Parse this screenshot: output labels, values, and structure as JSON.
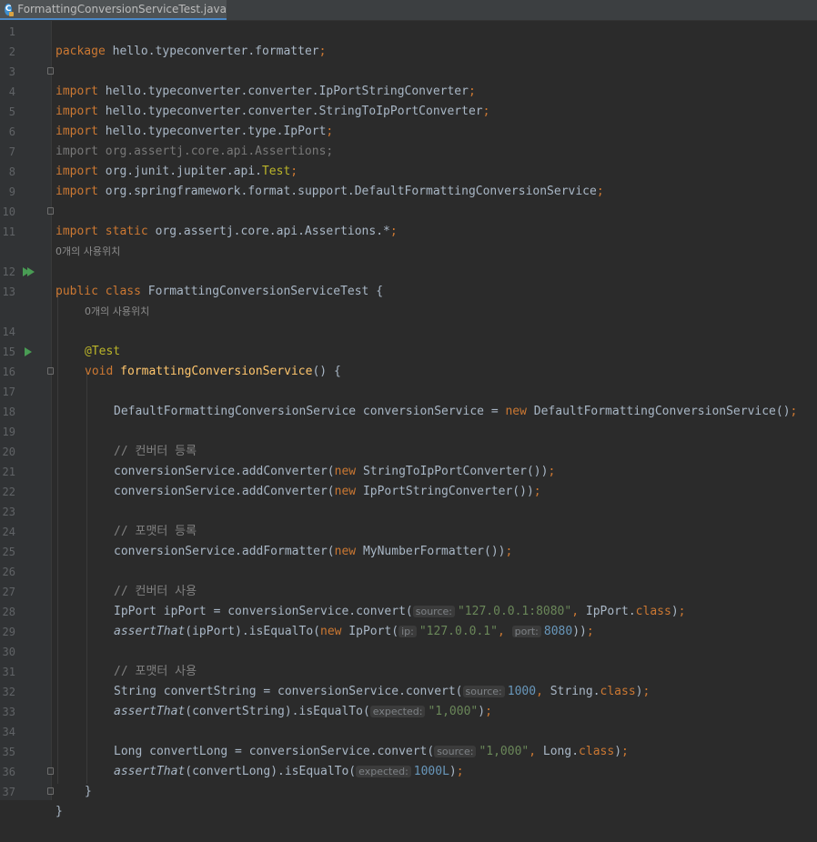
{
  "tab": {
    "title": "FormattingConversionServiceTest.java",
    "icon": "java-class-icon"
  },
  "colors": {
    "keyword": "#cc7832",
    "string": "#6a8759",
    "number": "#6897bb",
    "comment": "#808080",
    "annotation": "#bbb529",
    "method": "#ffc66d",
    "text": "#a9b7c6",
    "background": "#2b2b2b"
  },
  "hints": {
    "class_usages": "0개의 사용위치",
    "method_usages": "0개의 사용위치"
  },
  "line_numbers": [
    "1",
    "2",
    "3",
    "4",
    "5",
    "6",
    "7",
    "8",
    "9",
    "10",
    "11",
    "12",
    "13",
    "14",
    "15",
    "16",
    "17",
    "18",
    "19",
    "20",
    "21",
    "22",
    "23",
    "24",
    "25",
    "26",
    "27",
    "28",
    "29",
    "30",
    "31",
    "32",
    "33",
    "34",
    "35",
    "36",
    "37"
  ],
  "lines": {
    "l1": {
      "kw": "package",
      "rest": " hello.typeconverter.formatter",
      "semi": ";"
    },
    "l3": {
      "kw": "import",
      "rest": " hello.typeconverter.converter.IpPortStringConverter",
      "semi": ";"
    },
    "l4": {
      "kw": "import",
      "rest": " hello.typeconverter.converter.StringToIpPortConverter",
      "semi": ";"
    },
    "l5": {
      "kw": "import",
      "rest": " hello.typeconverter.type.IpPort",
      "semi": ";"
    },
    "l6": {
      "text": "import org.assertj.core.api.Assertions;"
    },
    "l7": {
      "kw": "import",
      "rest": " org.junit.jupiter.api.",
      "ann": "Test",
      "semi": ";"
    },
    "l8": {
      "kw": "import",
      "rest": " org.springframework.format.support.DefaultFormattingConversionService",
      "semi": ";"
    },
    "l10": {
      "kw": "import static",
      "rest": " org.assertj.core.api.Assertions.*",
      "semi": ";"
    },
    "l12": {
      "kw": "public class",
      "rest": " FormattingConversionServiceTest {"
    },
    "l14": {
      "ann": "@Test"
    },
    "l15": {
      "kw": "void",
      "fn": "formattingConversionService",
      "rest": "() {"
    },
    "l17": {
      "a": "DefaultFormattingConversionService conversionService = ",
      "kw": "new",
      "b": " DefaultFormattingConversionService()",
      "semi": ";"
    },
    "l19": {
      "cmt": "// 컨버터 등록"
    },
    "l20": {
      "a": "conversionService.addConverter(",
      "kw": "new",
      "b": " StringToIpPortConverter())",
      "semi": ";"
    },
    "l21": {
      "a": "conversionService.addConverter(",
      "kw": "new",
      "b": " IpPortStringConverter())",
      "semi": ";"
    },
    "l23": {
      "cmt": "// 포맷터 등록"
    },
    "l24": {
      "a": "conversionService.addFormatter(",
      "kw": "new",
      "b": " MyNumberFormatter())",
      "semi": ";"
    },
    "l26": {
      "cmt": "// 컨버터 사용"
    },
    "l27": {
      "a": "IpPort ipPort = conversionService.convert(",
      "hint": "source:",
      "str": "\"127.0.0.1:8080\"",
      "comma": ",",
      "b": " IpPort.",
      "kw": "class",
      "c": ")",
      "semi": ";"
    },
    "l28": {
      "it": "assertThat",
      "a": "(ipPort).isEqualTo(",
      "kw": "new",
      "b": " IpPort(",
      "hint1": "ip:",
      "str": "\"127.0.0.1\"",
      "comma": ",",
      "hint2": "port:",
      "num": "8080",
      "c": "))",
      "semi": ";"
    },
    "l30": {
      "cmt": "// 포맷터 사용"
    },
    "l31": {
      "a": "String convertString = conversionService.convert(",
      "hint": "source:",
      "num": "1000",
      "comma": ",",
      "b": " String.",
      "kw": "class",
      "c": ")",
      "semi": ";"
    },
    "l32": {
      "it": "assertThat",
      "a": "(convertString).isEqualTo(",
      "hint": "expected:",
      "str": "\"1,000\"",
      "c": ")",
      "semi": ";"
    },
    "l34": {
      "a": "Long convertLong = conversionService.convert(",
      "hint": "source:",
      "str": "\"1,000\"",
      "comma": ",",
      "b": " Long.",
      "kw": "class",
      "c": ")",
      "semi": ";"
    },
    "l35": {
      "it": "assertThat",
      "a": "(convertLong).isEqualTo(",
      "hint": "expected:",
      "num": "1000L",
      "c": ")",
      "semi": ";"
    },
    "l36": {
      "text": "}"
    },
    "l37": {
      "text": "}"
    }
  }
}
